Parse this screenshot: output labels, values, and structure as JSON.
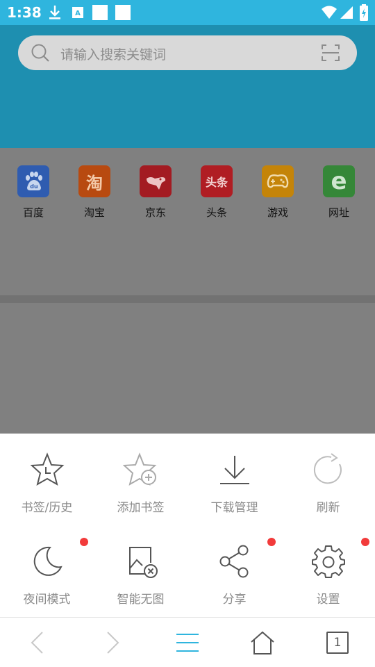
{
  "status_bar": {
    "time": "1:38",
    "bg_color": "#2fb5de"
  },
  "search": {
    "placeholder": "请输入搜索关键词"
  },
  "quick_links": [
    {
      "label": "百度",
      "color": "#2f6ad8",
      "glyph": "du"
    },
    {
      "label": "淘宝",
      "color": "#e45a0f",
      "glyph": "淘"
    },
    {
      "label": "京东",
      "color": "#c81b23",
      "glyph": ""
    },
    {
      "label": "头条",
      "color": "#d61f26",
      "glyph": "头条"
    },
    {
      "label": "游戏",
      "color": "#f2a20a",
      "glyph": ""
    },
    {
      "label": "网址",
      "color": "#3fa540",
      "glyph": "e"
    }
  ],
  "menu": {
    "items": [
      {
        "label": "书签/历史",
        "icon": "star-clock-icon",
        "badge": false
      },
      {
        "label": "添加书签",
        "icon": "star-add-icon",
        "badge": false
      },
      {
        "label": "下载管理",
        "icon": "download-icon",
        "badge": false
      },
      {
        "label": "刷新",
        "icon": "refresh-icon",
        "badge": false
      },
      {
        "label": "夜间模式",
        "icon": "moon-icon",
        "badge": true
      },
      {
        "label": "智能无图",
        "icon": "no-image-icon",
        "badge": false
      },
      {
        "label": "分享",
        "icon": "share-icon",
        "badge": true
      },
      {
        "label": "设置",
        "icon": "gear-icon",
        "badge": true
      }
    ]
  },
  "bottom_nav": {
    "tab_count": "1",
    "accent_color": "#2fb5de"
  }
}
